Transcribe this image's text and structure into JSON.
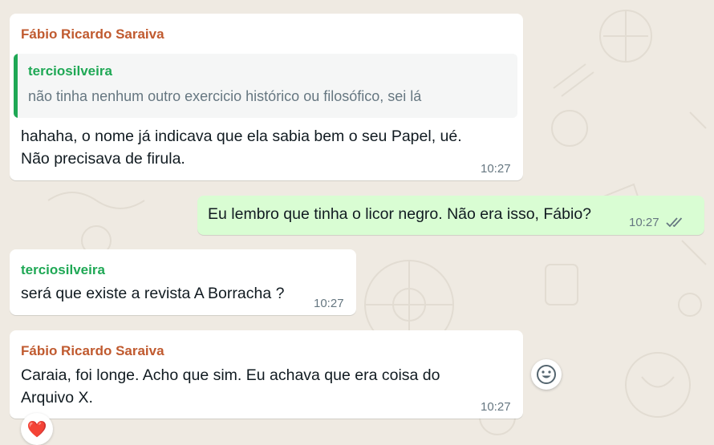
{
  "colors": {
    "background": "#efeae2",
    "incoming_bubble": "#ffffff",
    "outgoing_bubble": "#d9fdd3",
    "sender_fabio": "#c05a2f",
    "sender_tercio": "#1fa855",
    "quote_bar": "#1fa855",
    "read_ticks": "#667781"
  },
  "messages": [
    {
      "direction": "incoming",
      "sender": "Fábio Ricardo Saraiva",
      "quote": {
        "author": "terciosilveira",
        "text": "não tinha nenhum outro exercicio histórico ou filosófico, sei lá"
      },
      "lines": [
        "hahaha, o nome já indicava que ela sabia bem o seu Papel, ué.",
        "Não precisava de firula."
      ],
      "time": "10:27"
    },
    {
      "direction": "outgoing",
      "text": "Eu lembro que tinha o licor negro. Não era isso, Fábio?",
      "time": "10:27",
      "status_icon": "double-check-icon"
    },
    {
      "direction": "incoming",
      "sender": "terciosilveira",
      "text": "será que existe a revista A Borracha ?",
      "time": "10:27"
    },
    {
      "direction": "incoming",
      "sender": "Fábio Ricardo Saraiva",
      "lines": [
        "Caraia, foi longe. Acho que sim. Eu achava que era coisa do",
        "Arquivo X."
      ],
      "time": "10:27",
      "reaction": "❤️",
      "hover_action_icon": "smiley-icon"
    }
  ]
}
